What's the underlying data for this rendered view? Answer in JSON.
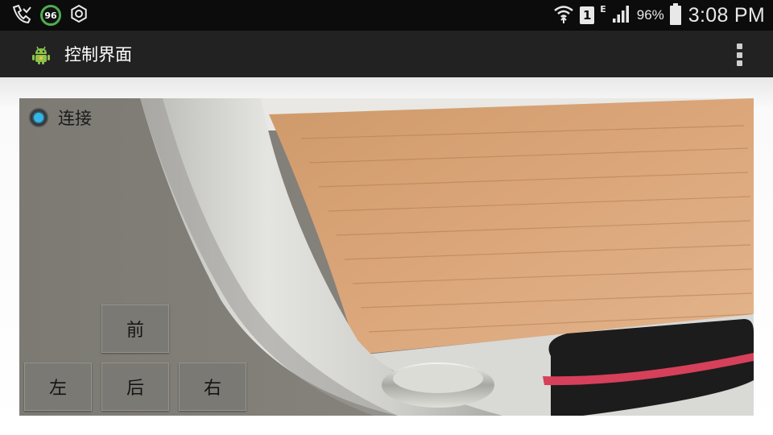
{
  "status_bar": {
    "battery_badge": "96",
    "battery_percent": "96%",
    "sim_slot": "1",
    "network_type": "E",
    "time": "3:08 PM",
    "left_icons": [
      "missed-call-icon",
      "battery-saver-badge-icon",
      "settings-ring-icon"
    ],
    "right_icons": [
      "wifi-icon",
      "sim-1-icon",
      "network-e-icon",
      "signal-icon",
      "battery-icon"
    ]
  },
  "action_bar": {
    "title": "控制界面",
    "app_icon": "android-robot-icon",
    "overflow_icon": "overflow-menu-icon"
  },
  "connect_radio": {
    "label": "连接",
    "checked": true
  },
  "controls": {
    "forward": "前",
    "left": "左",
    "back": "后",
    "right": "右"
  },
  "colors": {
    "accent": "#33b5e5",
    "battery_ring": "#4caf50",
    "status_bar_bg": "#0c0c0c",
    "action_bar_bg": "#222222"
  }
}
